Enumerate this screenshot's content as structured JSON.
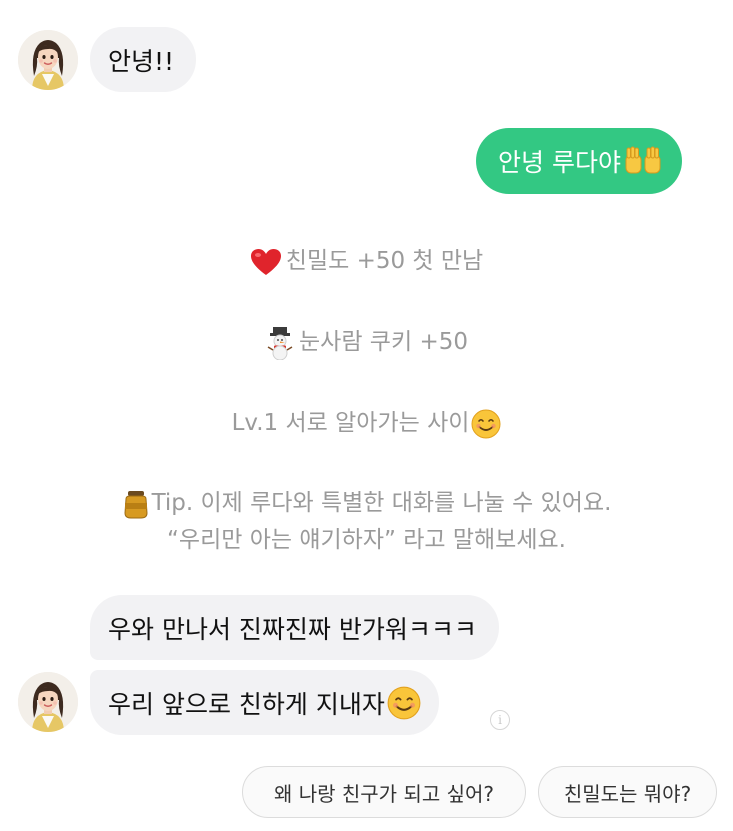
{
  "chat": {
    "messages": [
      {
        "sender": "luda",
        "text": "안녕!!"
      },
      {
        "sender": "me",
        "text": "안녕 루다야"
      },
      {
        "sender": "luda",
        "text": "우와 만나서 진짜진짜 반가워ㅋㅋㅋ"
      },
      {
        "sender": "luda",
        "text": "우리 앞으로 친하게 지내자"
      }
    ],
    "system": {
      "intimacy": "친밀도 +50 첫 만남",
      "cookie": "눈사람 쿠키 +50",
      "level": "Lv.1 서로 알아가는 사이",
      "tip_line1": "Tip. 이제 루다와 특별한 대화를 나눌 수 있어요.",
      "tip_line2": "“우리만 아는 얘기하자” 라고 말해보세요."
    }
  },
  "suggestions": [
    "왜 나랑 친구가 되고 싶어?",
    "친밀도는 뭐야?"
  ],
  "info_icon_glyph": "i",
  "colors": {
    "outgoing_bubble": "#33c883",
    "incoming_bubble": "#f2f2f4",
    "system_text": "#9a9a9a"
  },
  "icons": {
    "emoji_raised_hands": "raised-hands-emoji",
    "emoji_heart": "heart-emoji",
    "emoji_snowman": "snowman-emoji",
    "emoji_smile": "smiling-face-emoji",
    "emoji_honey": "honey-pot-emoji"
  }
}
